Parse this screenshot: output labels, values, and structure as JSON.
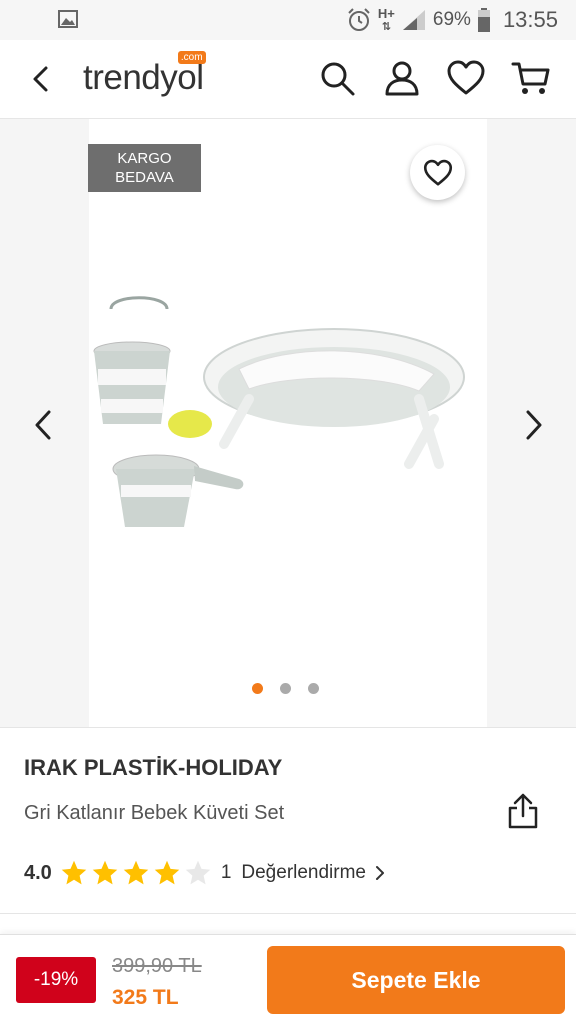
{
  "status_bar": {
    "battery": "69%",
    "time": "13:55",
    "network": "H+",
    "icons": [
      "gallery-icon",
      "alarm-icon",
      "network-icon",
      "signal-icon",
      "battery-icon"
    ]
  },
  "header": {
    "logo_text": "trendyol",
    "logo_badge": ".com",
    "icons": [
      "back-arrow-icon",
      "search-icon",
      "user-icon",
      "heart-icon",
      "cart-icon"
    ]
  },
  "gallery": {
    "badge": "KARGO BEDAVA",
    "dots": 3,
    "active_dot": 1
  },
  "product": {
    "brand": "IRAK PLASTİK-HOLIDAY",
    "name": "Gri Katlanır Bebek Küveti Set",
    "rating_value": "4.0",
    "stars": 4,
    "rating_count": "1",
    "rating_label": "Değerlendirme"
  },
  "purchase": {
    "discount": "-19%",
    "old_price": "399,90 TL",
    "new_price": "325 TL",
    "add_to_cart": "Sepete Ekle"
  },
  "colors": {
    "accent": "#f27a1a",
    "discount": "#d0021b",
    "star": "#ffc000"
  }
}
